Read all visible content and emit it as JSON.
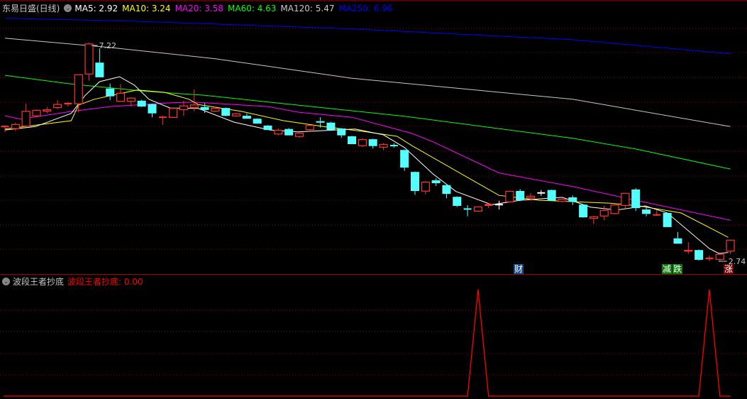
{
  "header": {
    "stock_name": "东易日盛(日线)",
    "ma": [
      {
        "label": "MA5: 2.92",
        "color": "#ffffff"
      },
      {
        "label": "MA10: 3.24",
        "color": "#ffff00"
      },
      {
        "label": "MA20: 3.58",
        "color": "#ff00ff"
      },
      {
        "label": "MA60: 4.63",
        "color": "#00ff00"
      },
      {
        "label": "MA120: 5.47",
        "color": "#c8c8c8"
      },
      {
        "label": "MA250: 6.96",
        "color": "#0000ff"
      }
    ]
  },
  "indicator": {
    "name": "波段王者抄底",
    "value_label": "波段王者抄底: 0.00"
  },
  "markers": {
    "cai": "财",
    "jian": "减",
    "die": "跌",
    "zhang": "涨"
  },
  "colors": {
    "up": "#ff3232",
    "down": "#54ffff",
    "grid": "#8b0000",
    "indicator": "#ff0000"
  },
  "chart_data": {
    "type": "candlestick",
    "ylim": [
      2.74,
      7.22
    ],
    "high_label": "7.22",
    "low_label": "2.74",
    "candles_ohlc": [
      [
        5.49,
        5.53,
        5.39,
        5.5
      ],
      [
        5.45,
        5.58,
        5.41,
        5.55
      ],
      [
        5.5,
        5.97,
        5.49,
        5.82
      ],
      [
        5.71,
        5.85,
        5.69,
        5.84
      ],
      [
        5.81,
        5.9,
        5.77,
        5.85
      ],
      [
        5.88,
        6.04,
        5.86,
        5.96
      ],
      [
        5.96,
        6.0,
        5.91,
        5.97
      ],
      [
        5.96,
        6.57,
        5.79,
        6.57
      ],
      [
        6.57,
        7.22,
        6.44,
        7.2
      ],
      [
        6.81,
        7.1,
        6.51,
        6.51
      ],
      [
        6.28,
        6.38,
        6.04,
        6.12
      ],
      [
        6.01,
        6.37,
        6.01,
        6.19
      ],
      [
        6.01,
        6.1,
        5.91,
        6.09
      ],
      [
        6.03,
        6.05,
        5.9,
        5.91
      ],
      [
        5.96,
        5.97,
        5.69,
        5.77
      ],
      [
        5.68,
        5.72,
        5.53,
        5.69
      ],
      [
        5.68,
        5.89,
        5.67,
        5.88
      ],
      [
        5.84,
        6.03,
        5.72,
        5.93
      ],
      [
        5.88,
        6.26,
        5.81,
        5.95
      ],
      [
        5.9,
        5.98,
        5.78,
        5.84
      ],
      [
        5.81,
        5.9,
        5.8,
        5.88
      ],
      [
        5.88,
        5.89,
        5.71,
        5.72
      ],
      [
        5.71,
        5.78,
        5.7,
        5.77
      ],
      [
        5.72,
        5.77,
        5.66,
        5.66
      ],
      [
        5.66,
        5.67,
        5.56,
        5.56
      ],
      [
        5.52,
        5.53,
        5.43,
        5.43
      ],
      [
        5.34,
        5.46,
        5.32,
        5.43
      ],
      [
        5.45,
        5.47,
        5.32,
        5.32
      ],
      [
        5.29,
        5.38,
        5.27,
        5.37
      ],
      [
        5.43,
        5.53,
        5.42,
        5.53
      ],
      [
        5.61,
        5.69,
        5.48,
        5.58
      ],
      [
        5.58,
        5.6,
        5.43,
        5.43
      ],
      [
        5.46,
        5.47,
        5.27,
        5.32
      ],
      [
        5.3,
        5.31,
        5.14,
        5.14
      ],
      [
        5.1,
        5.26,
        5.08,
        5.24
      ],
      [
        5.24,
        5.25,
        5.05,
        5.1
      ],
      [
        5.07,
        5.16,
        5.02,
        5.14
      ],
      [
        5.11,
        5.16,
        5.07,
        5.1
      ],
      [
        5.02,
        5.03,
        4.59,
        4.66
      ],
      [
        4.57,
        4.58,
        4.1,
        4.18
      ],
      [
        4.17,
        4.38,
        4.11,
        4.37
      ],
      [
        4.4,
        4.44,
        4.28,
        4.34
      ],
      [
        4.3,
        4.31,
        4.03,
        4.12
      ],
      [
        4.06,
        4.07,
        3.85,
        3.875
      ],
      [
        3.81,
        3.89,
        3.66,
        3.8
      ],
      [
        3.76,
        3.87,
        3.75,
        3.86
      ],
      [
        3.875,
        3.93,
        3.83,
        3.9
      ],
      [
        3.9,
        3.98,
        3.8,
        3.9
      ],
      [
        3.95,
        4.18,
        3.94,
        4.18
      ],
      [
        4.18,
        4.22,
        3.97,
        3.99
      ],
      [
        4.03,
        4.14,
        3.98,
        4.08
      ],
      [
        4.14,
        4.2,
        4.08,
        4.14
      ],
      [
        4.2,
        4.21,
        3.98,
        3.98
      ],
      [
        3.96,
        4.03,
        3.95,
        4.02
      ],
      [
        4.05,
        4.09,
        3.89,
        3.96
      ],
      [
        3.9,
        3.91,
        3.63,
        3.64
      ],
      [
        3.61,
        3.67,
        3.5,
        3.66
      ],
      [
        3.66,
        3.875,
        3.58,
        3.79
      ],
      [
        3.71,
        3.91,
        3.7,
        3.9
      ],
      [
        3.875,
        4.14,
        3.83,
        4.14
      ],
      [
        4.21,
        4.24,
        3.77,
        3.83
      ],
      [
        3.8,
        3.86,
        3.66,
        3.71
      ],
      [
        3.69,
        3.79,
        3.67,
        3.69
      ],
      [
        3.73,
        3.74,
        3.44,
        3.44
      ],
      [
        3.21,
        3.34,
        3.1,
        3.1
      ],
      [
        2.94,
        3.13,
        2.89,
        2.97
      ],
      [
        2.97,
        2.98,
        2.755,
        2.77
      ],
      [
        2.8,
        2.86,
        2.74,
        2.8
      ],
      [
        2.77,
        2.89,
        2.74,
        2.89
      ],
      [
        2.94,
        3.18,
        2.89,
        3.18
      ]
    ],
    "ma_series": [
      {
        "name": "MA250",
        "color": "#0000ff",
        "points": [
          [
            0,
            7.72
          ],
          [
            12,
            7.66
          ],
          [
            33,
            7.5
          ],
          [
            54,
            7.28
          ],
          [
            69,
            6.99
          ]
        ]
      },
      {
        "name": "MA120",
        "color": "#c8c8c8",
        "points": [
          [
            0,
            7.31
          ],
          [
            10,
            7.12
          ],
          [
            20,
            6.89
          ],
          [
            33,
            6.49
          ],
          [
            54,
            6.06
          ],
          [
            69,
            5.5
          ]
        ]
      },
      {
        "name": "MA60",
        "color": "#00ff00",
        "points": [
          [
            0,
            6.55
          ],
          [
            6,
            6.38
          ],
          [
            13,
            6.23
          ],
          [
            19,
            6.14
          ],
          [
            38,
            5.71
          ],
          [
            54,
            5.26
          ],
          [
            60,
            5.04
          ],
          [
            69,
            4.63
          ]
        ]
      },
      {
        "name": "MA20",
        "color": "#ff00ff",
        "points": [
          [
            0,
            5.72
          ],
          [
            1.5,
            5.65
          ],
          [
            6,
            5.8
          ],
          [
            10,
            5.91
          ],
          [
            16,
            5.99
          ],
          [
            18,
            6.0
          ],
          [
            25,
            5.91
          ],
          [
            28,
            5.79
          ],
          [
            33,
            5.69
          ],
          [
            38.7,
            5.36
          ],
          [
            40.8,
            5.18
          ],
          [
            47,
            4.55
          ],
          [
            54,
            4.27
          ],
          [
            60,
            3.99
          ],
          [
            69,
            3.58
          ]
        ]
      },
      {
        "name": "MA10",
        "color": "#ffff00",
        "points": [
          [
            0,
            5.45
          ],
          [
            6.3,
            5.62
          ],
          [
            7,
            5.94
          ],
          [
            8.5,
            6.06
          ],
          [
            10.8,
            6.17
          ],
          [
            12.6,
            6.25
          ],
          [
            15.2,
            6.2
          ],
          [
            17.5,
            6.06
          ],
          [
            18.4,
            5.95
          ],
          [
            22.5,
            5.81
          ],
          [
            26.5,
            5.62
          ],
          [
            30.6,
            5.49
          ],
          [
            34.1,
            5.4
          ],
          [
            37.3,
            5.3
          ],
          [
            38.7,
            5.11
          ],
          [
            47,
            4.09
          ],
          [
            50.8,
            3.99
          ],
          [
            57.6,
            3.93
          ],
          [
            60.3,
            3.875
          ],
          [
            64.3,
            3.73
          ],
          [
            68.8,
            3.23
          ]
        ]
      },
      {
        "name": "MA5",
        "color": "#ffffff",
        "points": [
          [
            0,
            5.43
          ],
          [
            2.9,
            5.5
          ],
          [
            6.3,
            5.77
          ],
          [
            7.6,
            6.13
          ],
          [
            9,
            6.42
          ],
          [
            10.9,
            6.52
          ],
          [
            12.3,
            6.35
          ],
          [
            13.7,
            6.06
          ],
          [
            15.7,
            5.88
          ],
          [
            18.4,
            5.87
          ],
          [
            21.8,
            5.59
          ],
          [
            25.2,
            5.43
          ],
          [
            27.9,
            5.39
          ],
          [
            30.6,
            5.42
          ],
          [
            33.3,
            5.45
          ],
          [
            36,
            5.33
          ],
          [
            38,
            5.07
          ],
          [
            40.7,
            4.53
          ],
          [
            42.9,
            4.17
          ],
          [
            46.3,
            3.9
          ],
          [
            49,
            3.99
          ],
          [
            53,
            4.05
          ],
          [
            55.7,
            3.85
          ],
          [
            58.2,
            3.79
          ],
          [
            60.9,
            3.875
          ],
          [
            63,
            3.73
          ],
          [
            67,
            3.0
          ],
          [
            67.9,
            2.9
          ],
          [
            68.8,
            2.92
          ]
        ]
      }
    ],
    "indicator_values": [
      0,
      0,
      0,
      0,
      0,
      0,
      0,
      0,
      0,
      0,
      0,
      0,
      0,
      0,
      0,
      0,
      0,
      0,
      0,
      0,
      0,
      0,
      0,
      0,
      0,
      0,
      0,
      0,
      0,
      0,
      0,
      0,
      0,
      0,
      0,
      0,
      0,
      0,
      0,
      0,
      0,
      0,
      0,
      0,
      0,
      1,
      0,
      0,
      0,
      0,
      0,
      0,
      0,
      0,
      0,
      0,
      0,
      0,
      0,
      0,
      0,
      0,
      0,
      0,
      0,
      0,
      0,
      1,
      0,
      0
    ],
    "indicator_ylim": [
      0,
      1
    ]
  }
}
